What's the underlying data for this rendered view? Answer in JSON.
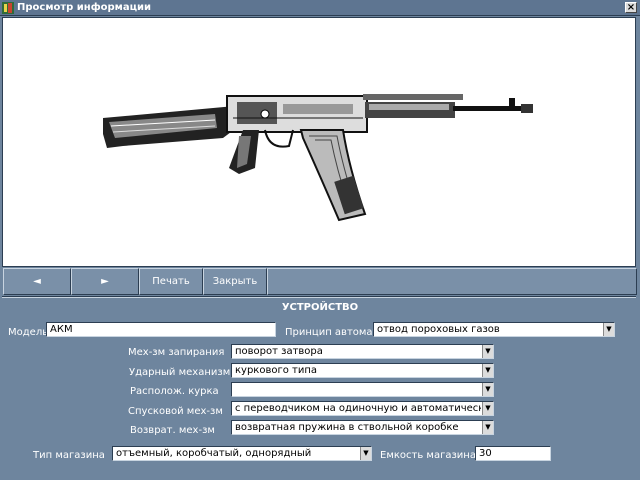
{
  "window": {
    "title": "Просмотр информации",
    "close_glyph": "×"
  },
  "toolbar": {
    "prev_label": "◄",
    "next_label": "►",
    "print_label": "Печать",
    "close_label": "Закрыть"
  },
  "section": {
    "title": "УСТРОЙСТВО"
  },
  "form": {
    "model_label": "Модель",
    "model_value": "АКМ",
    "automation_label": "Принцип автомат.",
    "automation_value": "отвод пороховых газов",
    "locking_label": "Мех-зм запирания",
    "locking_value": "поворот затвора",
    "firing_label": "Ударный механизм",
    "firing_value": "куркового типа",
    "hammer_label": "Располож. курка",
    "hammer_value": "",
    "trigger_label": "Спусковой мех-зм",
    "trigger_value": "с переводчиком на одиночную и автоматическую стрельбу",
    "return_label": "Возврат. мех-зм",
    "return_value": "возвратная пружина в ствольной коробке",
    "magazine_type_label": "Тип магазина",
    "magazine_type_value": "отъемный, коробчатый, однорядный",
    "magazine_capacity_label": "Емкость магазина",
    "magazine_capacity_value": "30"
  },
  "icons": {
    "app": "app-icon",
    "close": "close-icon",
    "combo_arrow": "▼"
  }
}
